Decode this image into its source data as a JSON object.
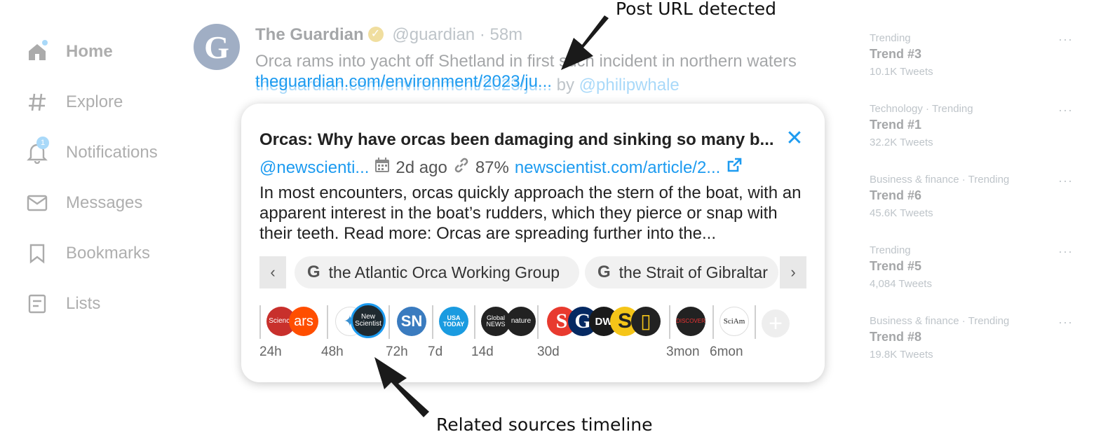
{
  "sidebar": {
    "items": [
      {
        "label": "Home",
        "icon": "home-icon"
      },
      {
        "label": "Explore",
        "icon": "hashtag-icon"
      },
      {
        "label": "Notifications",
        "icon": "bell-icon",
        "badge": "1"
      },
      {
        "label": "Messages",
        "icon": "envelope-icon"
      },
      {
        "label": "Bookmarks",
        "icon": "bookmark-icon"
      },
      {
        "label": "Lists",
        "icon": "list-icon"
      }
    ]
  },
  "tweet": {
    "avatar_letter": "G",
    "name": "The Guardian",
    "handle": "@guardian",
    "separator": "·",
    "time": "58m",
    "text": "Orca rams into yacht off Shetland in first such incident in northern waters",
    "link": "theguardian.com/environment/2023/ju...",
    "by": "by",
    "author": "@philipwhale"
  },
  "card": {
    "title": "Orcas: Why have orcas been damaging and sinking so many b...",
    "handle": "@newscienti...",
    "date": "2d ago",
    "match": "87%",
    "url": "newscientist.com/article/2...",
    "summary": "In most encounters, orcas quickly approach the stern of the boat, with an apparent interest in the boat’s rudders, which they pierce or snap with their teeth. Read more: Orcas are spreading further into the...",
    "chips": [
      {
        "label": "the Atlantic Orca Working Group"
      },
      {
        "label": "the Strait of Gibraltar"
      }
    ],
    "timeline_labels": [
      "24h",
      "48h",
      "72h",
      "7d",
      "14d",
      "30d",
      "3mon",
      "6mon"
    ],
    "sources": [
      {
        "label": "Science",
        "color": "#c8302c"
      },
      {
        "label": "ars",
        "color": "#ff4e00"
      },
      {
        "label": "✦",
        "color": "#ffffff"
      },
      {
        "label": "New Scientist",
        "color": "#1f2a30"
      },
      {
        "label": "SN",
        "color": "#3a7bbf"
      },
      {
        "label": "USA TODAY",
        "color": "#1a9be0"
      },
      {
        "label": "Global NEWS",
        "color": "#222222"
      },
      {
        "label": "nature",
        "color": "#222222"
      },
      {
        "label": "S",
        "color": "#e83a2f"
      },
      {
        "label": "G",
        "color": "#052962"
      },
      {
        "label": "DW",
        "color": "#1a1a1a"
      },
      {
        "label": "S",
        "color": "#f5c518"
      },
      {
        "label": "▯",
        "color": "#222222"
      },
      {
        "label": "DISCOVER",
        "color": "#222222"
      },
      {
        "label": "SciAm",
        "color": "#ffffff"
      }
    ]
  },
  "trends": [
    {
      "category": "Trending",
      "name": "Trend #3",
      "count": "10.1K Tweets"
    },
    {
      "category": "Technology · Trending",
      "name": "Trend #1",
      "count": "32.2K Tweets"
    },
    {
      "category": "Business & finance · Trending",
      "name": "Trend #6",
      "count": "45.6K Tweets"
    },
    {
      "category": "Trending",
      "name": "Trend #5",
      "count": "4,084 Tweets"
    },
    {
      "category": "Business & finance · Trending",
      "name": "Trend #8",
      "count": "19.8K Tweets"
    }
  ],
  "trend_more": "···",
  "annotations": {
    "top": "Post URL detected",
    "bottom": "Related sources timeline"
  },
  "colors": {
    "accent": "#1d9bf0",
    "highlight_ring": "#1d9bf0"
  }
}
